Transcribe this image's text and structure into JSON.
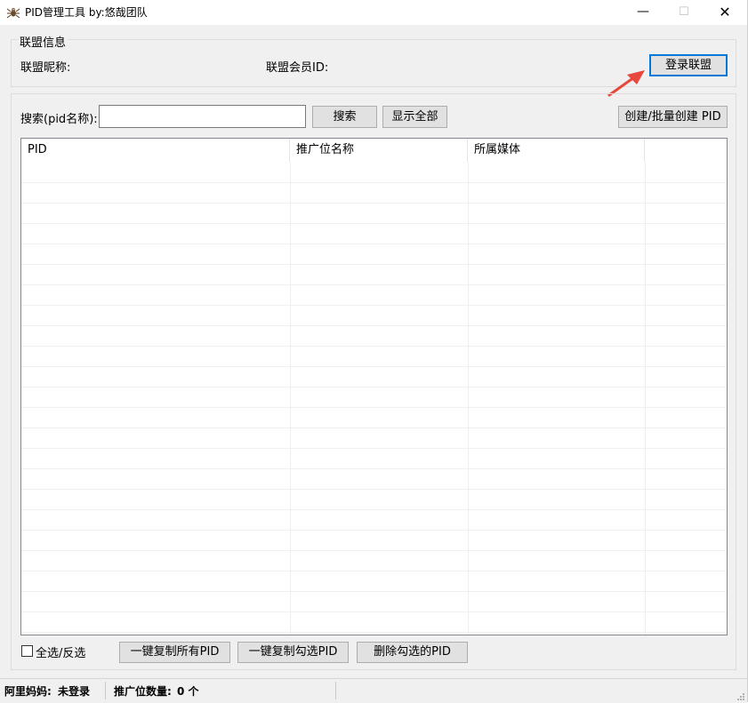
{
  "window": {
    "title": "PID管理工具  by:悠哉团队",
    "minimize_glyph": "—",
    "maximize_glyph": "☐",
    "close_glyph": "✕",
    "icon": "spider-icon"
  },
  "alliance": {
    "group_title": "联盟信息",
    "nickname_label": "联盟昵称:",
    "member_id_label": "联盟会员ID:",
    "login_button": "登录联盟"
  },
  "search": {
    "label": "搜索(pid名称):",
    "value": "",
    "placeholder": "",
    "search_button": "搜索",
    "show_all_button": "显示全部",
    "create_button": "创建/批量创建 PID"
  },
  "table": {
    "columns": [
      "PID",
      "推广位名称",
      "所属媒体",
      ""
    ],
    "rows": []
  },
  "actions": {
    "select_all_label": "全选/反选",
    "select_all_checked": false,
    "copy_all_button": "一键复制所有PID",
    "copy_checked_button": "一键复制勾选PID",
    "delete_checked_button": "删除勾选的PID"
  },
  "status": {
    "alimama_label": "阿里妈妈:",
    "alimama_value": "未登录",
    "count_label": "推广位数量:",
    "count_value": "0 个"
  },
  "colors": {
    "accent": "#0078d7",
    "annotation_arrow": "#e8473c"
  }
}
